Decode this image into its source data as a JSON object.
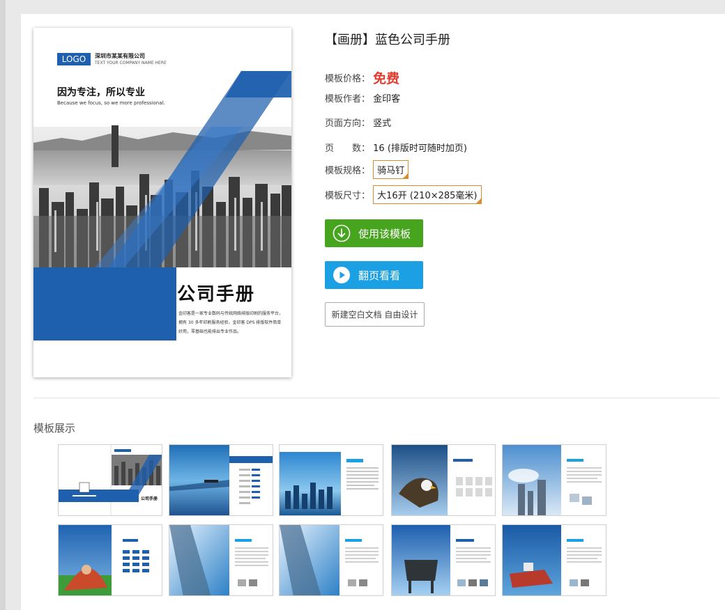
{
  "product": {
    "title": "【画册】蓝色公司手册",
    "price_label": "模板价格：",
    "price_value": "免费",
    "author_label": "模板作者：",
    "author_value": "金印客",
    "orientation_label": "页面方向：",
    "orientation_value": "竖式",
    "pages_label": "页　　数：",
    "pages_value": "16 (排版时可随时加页)",
    "binding_label": "模板规格：",
    "binding_value": "骑马钉",
    "size_label": "模板尺寸：",
    "size_value": "大16开 (210×285毫米)"
  },
  "buttons": {
    "use_template": "使用该模板",
    "flip_view": "翻页看看",
    "new_blank": "新建空白文档 自由设计"
  },
  "cover": {
    "logo": "LOGO",
    "company_cn": "深圳市某某有限公司",
    "company_en": "TEXT YOUR COMPANY NAME HERE",
    "slogan": "因为专注，所以专业",
    "slogan_en": "Because we focus, so we more professional.",
    "big_title": "公司手册",
    "description": "金印客是一家专业数码与传统网络排版印刷的服务平台，拥有 30 多年印刷服务经验，金印客 DPS 排版软件简单好用，零基础也能排出专业作品。"
  },
  "showcase": {
    "title": "模板展示"
  },
  "colors": {
    "brand_blue": "#1e5fae",
    "price_red": "#e23c2e",
    "use_green": "#47a41e",
    "flip_blue": "#1aa0e3",
    "tag_orange": "#d98b2e"
  },
  "icons": {
    "use_template": "download-circle-icon",
    "flip_view": "play-circle-icon",
    "tag_corner": "check-corner-icon"
  }
}
